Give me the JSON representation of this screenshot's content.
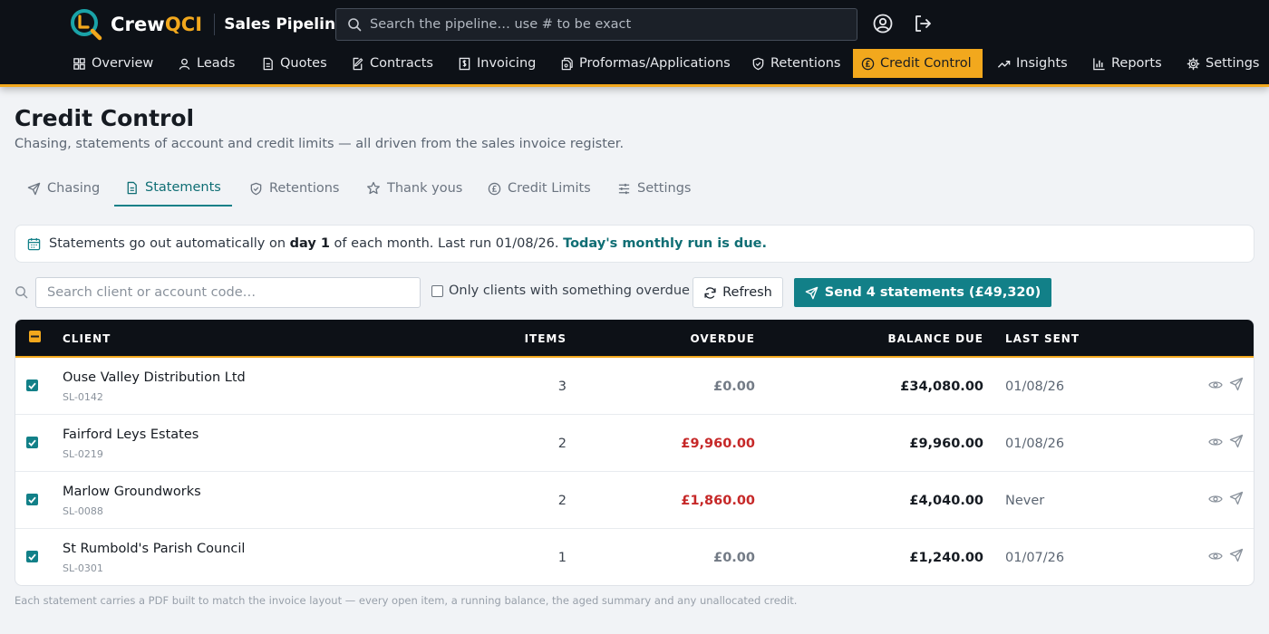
{
  "header": {
    "brand_prefix": "Crew",
    "brand_suffix": "QCI",
    "app_title": "Sales Pipeline",
    "search_placeholder": "Search the pipeline… use # to be exact",
    "accent_color": "#f2a81d",
    "profile_icon": "user-circle-icon",
    "logout_icon": "logout-icon"
  },
  "nav": [
    {
      "label": "Overview",
      "icon": "grid-icon"
    },
    {
      "label": "Leads",
      "icon": "user-icon"
    },
    {
      "label": "Quotes",
      "icon": "document-icon"
    },
    {
      "label": "Contracts",
      "icon": "file-edit-icon"
    },
    {
      "label": "Invoicing",
      "icon": "invoice-icon"
    },
    {
      "label": "Proformas/Applications",
      "icon": "files-icon"
    },
    {
      "label": "Retentions",
      "icon": "shield-icon"
    },
    {
      "label": "Credit Control",
      "icon": "pound-coin-icon",
      "active": true
    },
    {
      "label": "Insights",
      "icon": "trend-icon"
    },
    {
      "label": "Reports",
      "icon": "bar-chart-icon"
    },
    {
      "label": "Settings",
      "icon": "gear-icon"
    }
  ],
  "page": {
    "title": "Credit Control",
    "subtitle": "Chasing, statements of account and credit limits — all driven from the sales invoice register."
  },
  "tabs": [
    {
      "label": "Chasing",
      "icon": "send-icon"
    },
    {
      "label": "Statements",
      "icon": "document-icon",
      "active": true
    },
    {
      "label": "Retentions",
      "icon": "shield-icon"
    },
    {
      "label": "Thank yous",
      "icon": "star-icon"
    },
    {
      "label": "Credit Limits",
      "icon": "pound-coin-icon"
    },
    {
      "label": "Settings",
      "icon": "sliders-icon"
    }
  ],
  "banner": {
    "text_before": "Statements go out automatically on ",
    "day": "day 1",
    "text_mid": " of each month. Last run 01/08/26. ",
    "due": "Today's monthly run is due."
  },
  "toolbar": {
    "search_placeholder": "Search client or account code…",
    "overdue_filter_label": "Only clients with something overdue",
    "refresh_label": "Refresh",
    "send_label": "Send 4 statements (£49,320)"
  },
  "table": {
    "columns": {
      "client": "CLIENT",
      "items": "ITEMS",
      "overdue": "OVERDUE",
      "balance": "BALANCE DUE",
      "last_sent": "LAST SENT"
    },
    "rows": [
      {
        "client": "Ouse Valley Distribution Ltd",
        "code": "SL-0142",
        "items": "3",
        "overdue": "£0.00",
        "overdue_flag": false,
        "balance": "£34,080.00",
        "last_sent": "01/08/26"
      },
      {
        "client": "Fairford Leys Estates",
        "code": "SL-0219",
        "items": "2",
        "overdue": "£9,960.00",
        "overdue_flag": true,
        "balance": "£9,960.00",
        "last_sent": "01/08/26"
      },
      {
        "client": "Marlow Groundworks",
        "code": "SL-0088",
        "items": "2",
        "overdue": "£1,860.00",
        "overdue_flag": true,
        "balance": "£4,040.00",
        "last_sent": "Never"
      },
      {
        "client": "St Rumbold's Parish Council",
        "code": "SL-0301",
        "items": "1",
        "overdue": "£0.00",
        "overdue_flag": false,
        "balance": "£1,240.00",
        "last_sent": "01/07/26"
      }
    ]
  },
  "footnote": "Each statement carries a PDF built to match the invoice layout — every open item, a running balance, the aged summary and any unallocated credit."
}
